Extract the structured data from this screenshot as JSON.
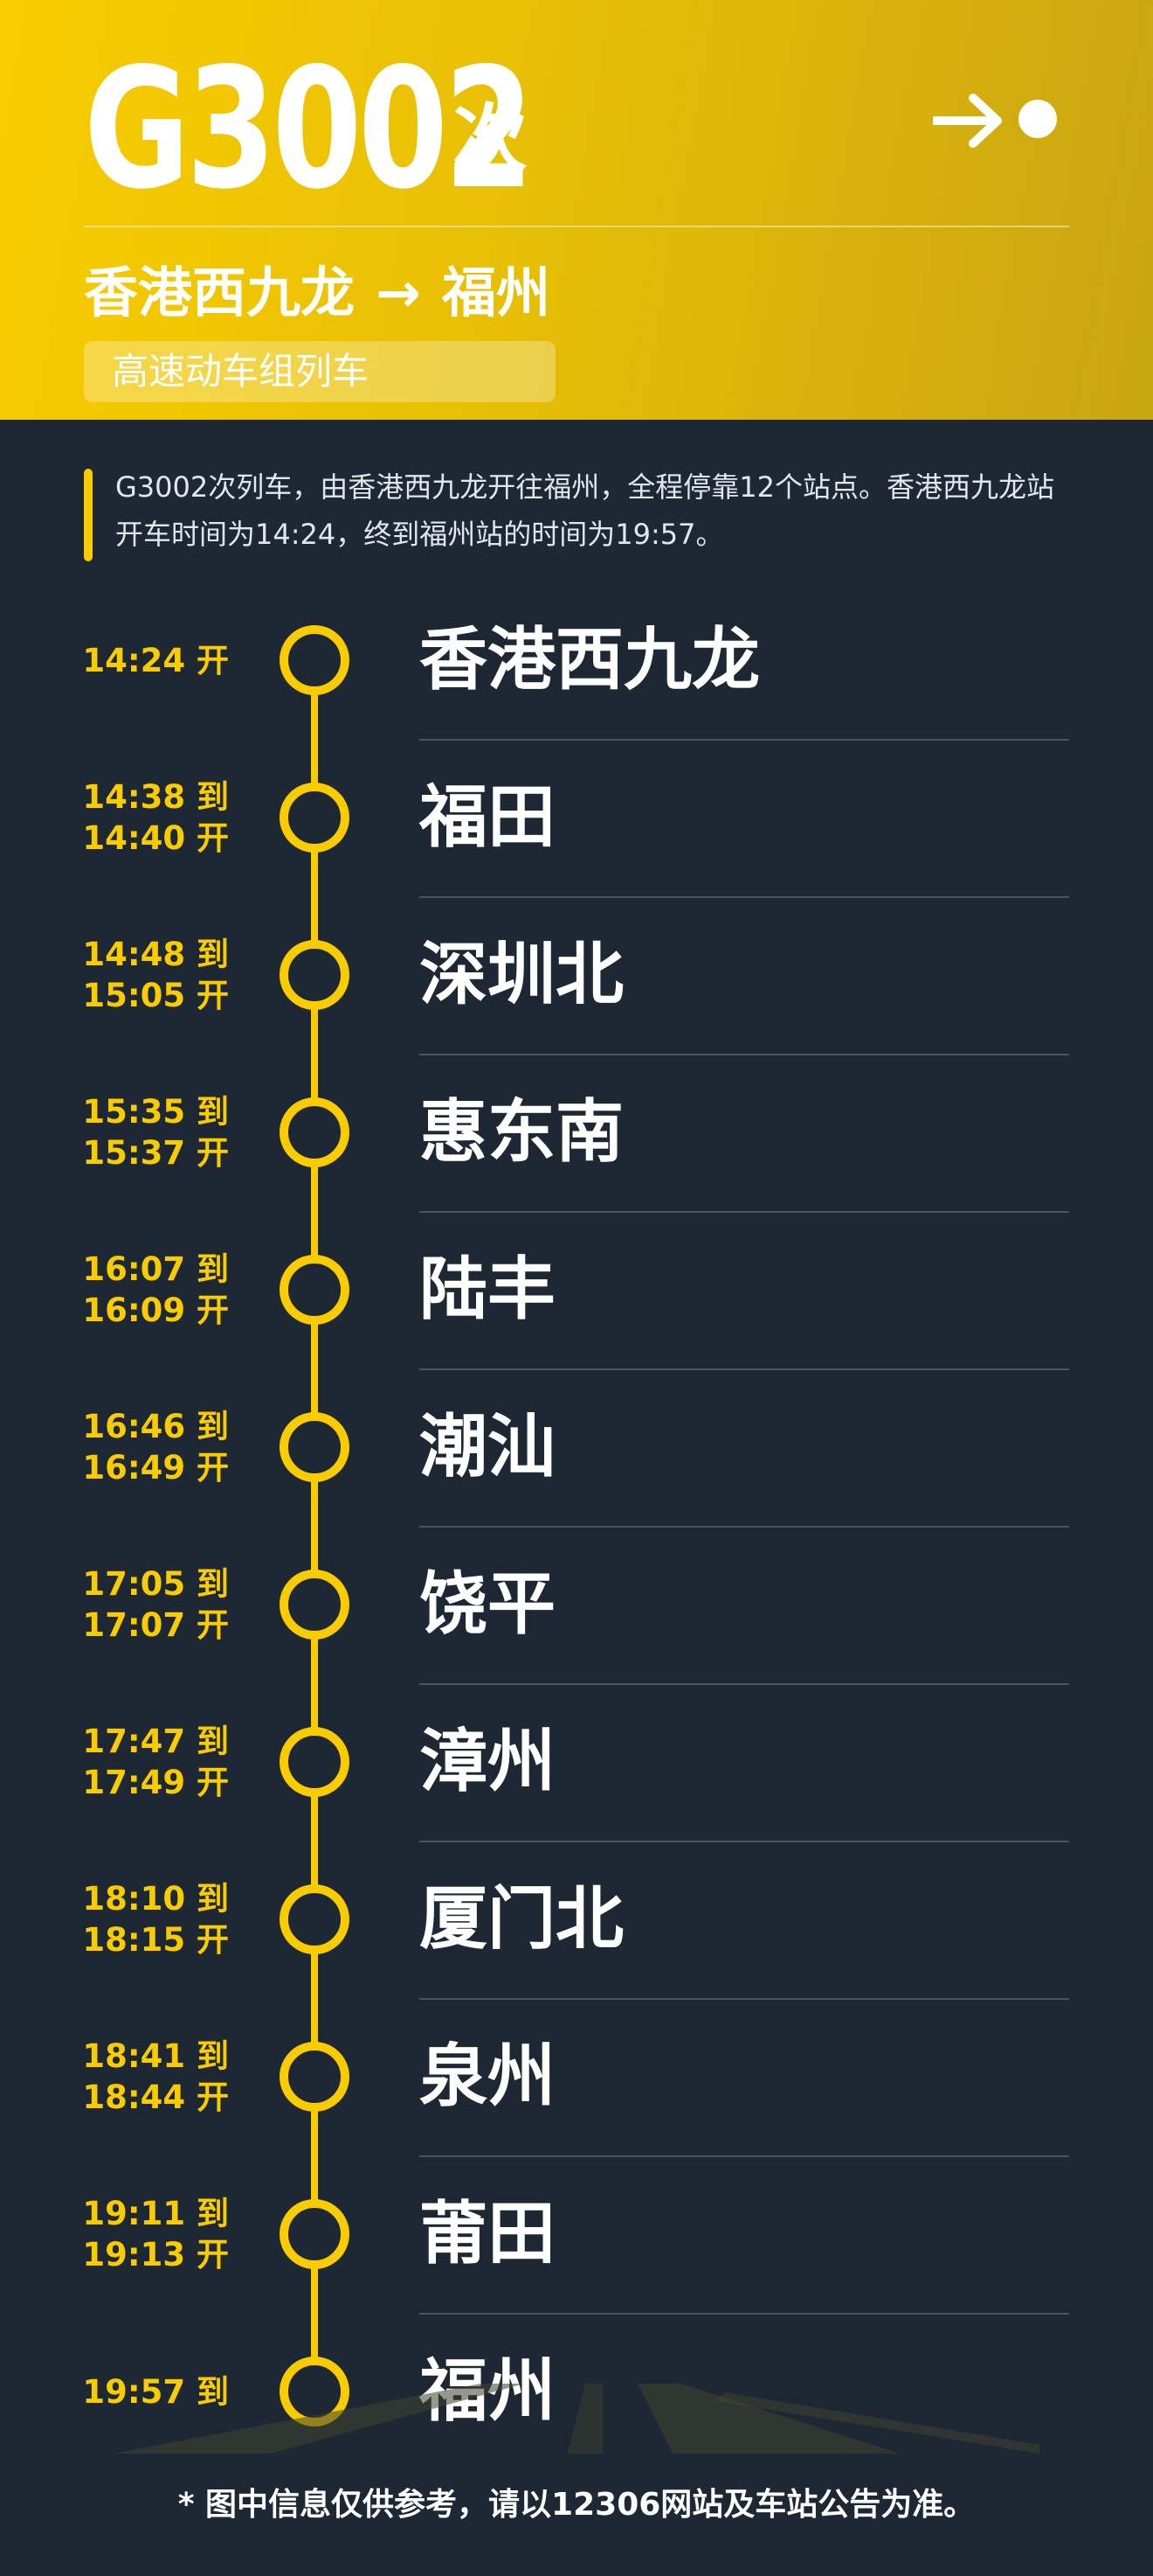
{
  "header": {
    "train_number": "G3002",
    "train_suffix": "次",
    "route": {
      "origin": "香港西九龙",
      "arrow": "→",
      "destination": "福州"
    },
    "train_type": "高速动车组列车",
    "icon": "arrow-right-dot-icon"
  },
  "intro": "G3002次列车，由香港西九龙开往福州，全程停靠12个站点。香港西九龙站开车时间为14:24，终到福州站的时间为19:57。",
  "stops": [
    {
      "name": "香港西九龙",
      "line1": "14:24 开",
      "line2": ""
    },
    {
      "name": "福田",
      "line1": "14:38 到",
      "line2": "14:40 开"
    },
    {
      "name": "深圳北",
      "line1": "14:48 到",
      "line2": "15:05 开"
    },
    {
      "name": "惠东南",
      "line1": "15:35 到",
      "line2": "15:37 开"
    },
    {
      "name": "陆丰",
      "line1": "16:07 到",
      "line2": "16:09 开"
    },
    {
      "name": "潮汕",
      "line1": "16:46 到",
      "line2": "16:49 开"
    },
    {
      "name": "饶平",
      "line1": "17:05 到",
      "line2": "17:07 开"
    },
    {
      "name": "漳州",
      "line1": "17:47 到",
      "line2": "17:49 开"
    },
    {
      "name": "厦门北",
      "line1": "18:10 到",
      "line2": "18:15 开"
    },
    {
      "name": "泉州",
      "line1": "18:41 到",
      "line2": "18:44 开"
    },
    {
      "name": "莆田",
      "line1": "19:11 到",
      "line2": "19:13 开"
    },
    {
      "name": "福州",
      "line1": "19:57 到",
      "line2": ""
    }
  ],
  "footnote": "* 图中信息仅供参考，请以12306网站及车站公告为准。",
  "colors": {
    "accent": "#f9cc00",
    "background": "#1e2734",
    "text": "#ffffff"
  }
}
